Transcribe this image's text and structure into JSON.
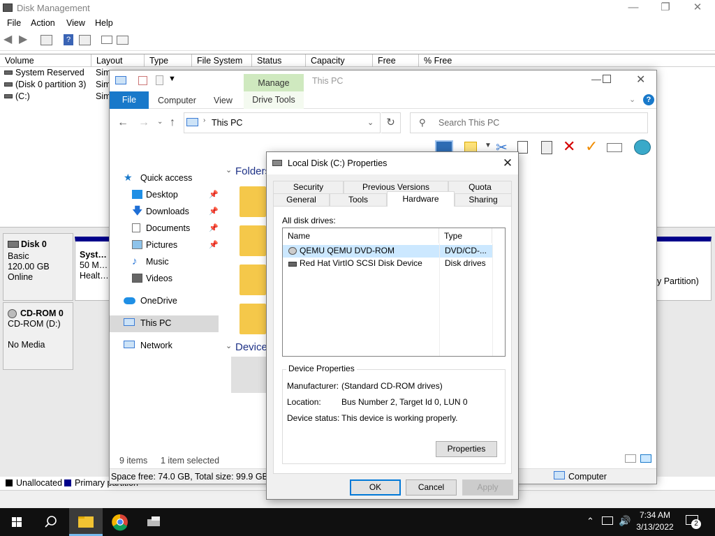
{
  "diskmgmt": {
    "title": "Disk Management",
    "menu": [
      "File",
      "Action",
      "View",
      "Help"
    ],
    "columns": [
      "Volume",
      "Layout",
      "Type",
      "File System",
      "Status",
      "Capacity",
      "Free Spa...",
      "% Free"
    ],
    "volumes": [
      {
        "name": "System Reserved",
        "layout": "Sim"
      },
      {
        "name": "(Disk 0 partition 3)",
        "layout": "Sim"
      },
      {
        "name": "(C:)",
        "layout": "Sim"
      }
    ],
    "disk0": {
      "name": "Disk 0",
      "type": "Basic",
      "size": "120.00 GB",
      "status": "Online",
      "part_name": "System",
      "part_size": "50 MB N",
      "part_status": "Healthy",
      "right_text": "y Partition)"
    },
    "cdrom0": {
      "name": "CD-ROM 0",
      "drive": "CD-ROM (D:)",
      "media": "No Media"
    },
    "legend": {
      "unallocated": "Unallocated",
      "primary": "Primary partition"
    },
    "colors": {
      "unallocated": "#000000",
      "primary": "#00008b"
    }
  },
  "explorer": {
    "title": "This PC",
    "manage_tab": "Manage",
    "ribbon_tabs": [
      "File",
      "Computer",
      "View",
      "Drive Tools"
    ],
    "address": "This PC",
    "search_placeholder": "Search This PC",
    "nav": [
      {
        "label": "Quick access",
        "pinned": false
      },
      {
        "label": "Desktop",
        "pinned": true
      },
      {
        "label": "Downloads",
        "pinned": true
      },
      {
        "label": "Documents",
        "pinned": true
      },
      {
        "label": "Pictures",
        "pinned": true
      },
      {
        "label": "Music",
        "pinned": false
      },
      {
        "label": "Videos",
        "pinned": false
      },
      {
        "label": "OneDrive",
        "pinned": false
      },
      {
        "label": "This PC",
        "pinned": false
      },
      {
        "label": "Network",
        "pinned": false
      }
    ],
    "group_folders": "Folders",
    "group_devices": "Device",
    "status_items": "9 items",
    "status_selected": "1 item selected",
    "space_info": "Space free: 74.0 GB, Total size: 99.9 GB",
    "computer_label": "Computer"
  },
  "dialog": {
    "title": "Local Disk (C:) Properties",
    "tabs_row1": [
      "Security",
      "Previous Versions",
      "Quota"
    ],
    "tabs_row2": [
      "General",
      "Tools",
      "Hardware",
      "Sharing"
    ],
    "active_tab": "Hardware",
    "all_drives_label": "All disk drives:",
    "list_headers": [
      "Name",
      "Type"
    ],
    "drives": [
      {
        "name": "QEMU QEMU DVD-ROM",
        "type": "DVD/CD-..."
      },
      {
        "name": "Red Hat VirtIO SCSI Disk Device",
        "type": "Disk drives"
      }
    ],
    "device_props_title": "Device Properties",
    "manufacturer_label": "Manufacturer:",
    "manufacturer": "(Standard CD-ROM drives)",
    "location_label": "Location:",
    "location": "Bus Number 2, Target Id 0, LUN 0",
    "device_status_label": "Device status:",
    "device_status": "This device is working properly.",
    "properties_btn": "Properties",
    "ok": "OK",
    "cancel": "Cancel",
    "apply": "Apply"
  },
  "taskbar": {
    "time": "7:34 AM",
    "date": "3/13/2022",
    "notification_count": "2",
    "accent": "#76b9ed"
  }
}
